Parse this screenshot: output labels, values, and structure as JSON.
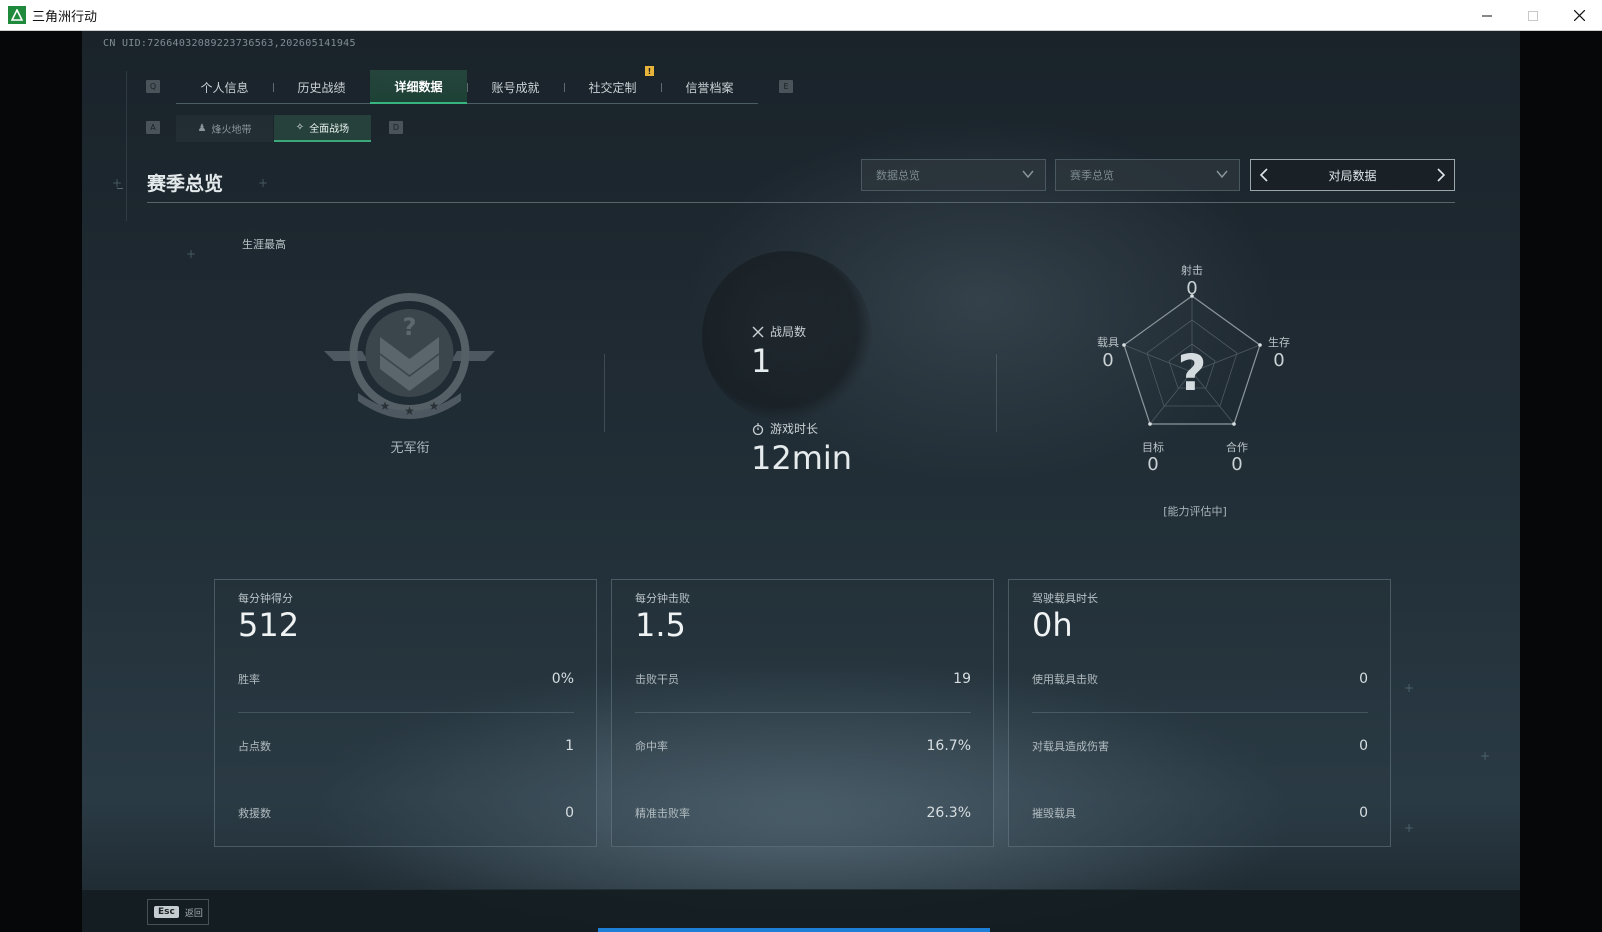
{
  "window": {
    "title": "三角洲行动",
    "controls": [
      "minimize",
      "maximize",
      "close"
    ]
  },
  "uid_text": "CN UID:7266403208922373656​3,202605141945",
  "main_tabs": {
    "key_left": "Q",
    "key_right": "E",
    "items": [
      {
        "label": "个人信息"
      },
      {
        "label": "历史战绩"
      },
      {
        "label": "详细数据",
        "active": true
      },
      {
        "label": "账号成就"
      },
      {
        "label": "社交定制",
        "badge": "!"
      },
      {
        "label": "信誉档案"
      }
    ]
  },
  "sub_tabs": {
    "key_left": "A",
    "key_right": "D",
    "items": [
      {
        "label": "烽火地带",
        "icon": "person-icon"
      },
      {
        "label": "全面战场",
        "icon": "crosshair-icon",
        "active": true
      }
    ]
  },
  "section": {
    "title": "赛季总览",
    "dropdown1": "数据总览",
    "dropdown2": "赛季总览",
    "pager_label": "对局数据"
  },
  "career": {
    "label": "生涯最高",
    "rank_name": "无军衔"
  },
  "overview": {
    "matches_label": "战局数",
    "matches_value": "1",
    "playtime_label": "游戏时长",
    "playtime_value": "12min"
  },
  "radar": {
    "axes": [
      {
        "label": "射击",
        "value": "0"
      },
      {
        "label": "生存",
        "value": "0"
      },
      {
        "label": "合作",
        "value": "0"
      },
      {
        "label": "目标",
        "value": "0"
      },
      {
        "label": "载具",
        "value": "0"
      }
    ],
    "center": "?",
    "note": "[能力评估中]"
  },
  "cards": [
    {
      "head_label": "每分钟得分",
      "head_value": "512",
      "rows": [
        {
          "k": "胜率",
          "v": "0%"
        },
        {
          "k": "占点数",
          "v": "1"
        },
        {
          "k": "救援数",
          "v": "0"
        }
      ]
    },
    {
      "head_label": "每分钟击败",
      "head_value": "1.5",
      "rows": [
        {
          "k": "击败干员",
          "v": "19"
        },
        {
          "k": "命中率",
          "v": "16.7%"
        },
        {
          "k": "精准击败率",
          "v": "26.3%"
        }
      ]
    },
    {
      "head_label": "驾驶载具时长",
      "head_value": "0h",
      "rows": [
        {
          "k": "使用载具击败",
          "v": "0"
        },
        {
          "k": "对载具造成伤害",
          "v": "0"
        },
        {
          "k": "摧毁载具",
          "v": "0"
        }
      ]
    }
  ],
  "footer": {
    "esc_key": "Esc",
    "esc_label": "返回"
  },
  "colors": {
    "accent_green": "#38b47e",
    "badge_yellow": "#e9b43a",
    "progress_blue": "#1e7fd6"
  }
}
